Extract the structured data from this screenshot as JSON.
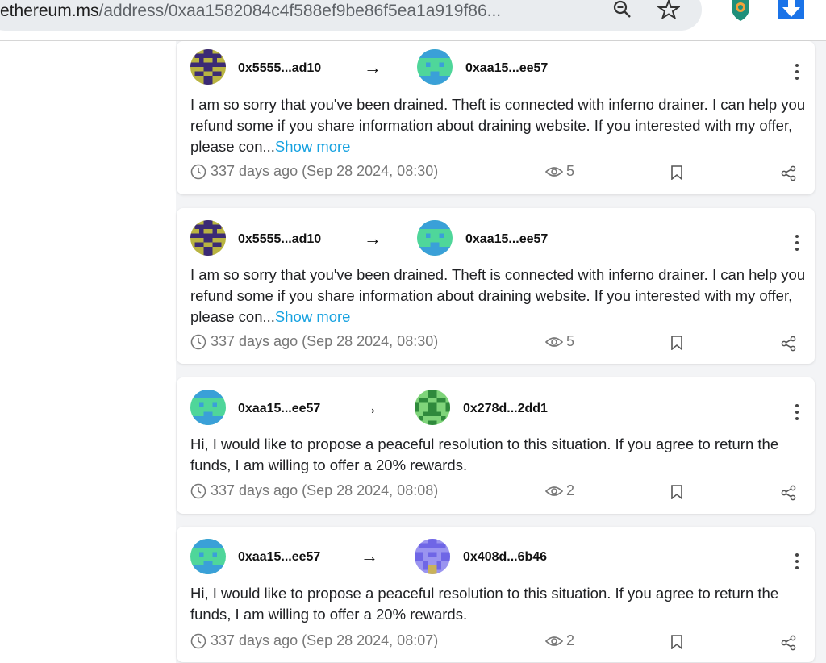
{
  "browser": {
    "url_host": "ethereum.ms",
    "url_path": "/address/0xaa1582084c4f588ef9be86f5ea1a919f86..."
  },
  "ui": {
    "show_more_label": "Show more"
  },
  "cards": [
    {
      "from": "0x5555...ad10",
      "to": "0xaa15...ee57",
      "message": "I am so sorry that you've been drained. Theft is connected with inferno drainer. I can help you refund some if you share information about draining website. If you interested with my offer, please con...",
      "has_show_more": true,
      "time": "337 days ago (Sep 28 2024, 08:30)",
      "views": "5"
    },
    {
      "from": "0x5555...ad10",
      "to": "0xaa15...ee57",
      "message": "I am so sorry that you've been drained. Theft is connected with inferno drainer. I can help you refund some if you share information about draining website. If you interested with my offer, please con...",
      "has_show_more": true,
      "time": "337 days ago (Sep 28 2024, 08:30)",
      "views": "5"
    },
    {
      "from": "0xaa15...ee57",
      "to": "0x278d...2dd1",
      "message": "Hi, I would like to propose a peaceful resolution to this situation. If you agree to return the funds, I am willing to offer a 20% rewards.",
      "has_show_more": false,
      "time": "337 days ago (Sep 28 2024, 08:08)",
      "views": "2"
    },
    {
      "from": "0xaa15...ee57",
      "to": "0x408d...6b46",
      "message": "Hi, I would like to propose a peaceful resolution to this situation. If you agree to return the funds, I am willing to offer a 20% rewards.",
      "has_show_more": false,
      "time": "337 days ago (Sep 28 2024, 08:07)",
      "views": "2"
    }
  ],
  "colors": {
    "link": "#17a2e0",
    "avatar_5555": "#3b2a75",
    "avatar_aa15": "#4fd69a",
    "avatar_278d": "#2f8a3c",
    "avatar_408d": "#6f66e6"
  }
}
